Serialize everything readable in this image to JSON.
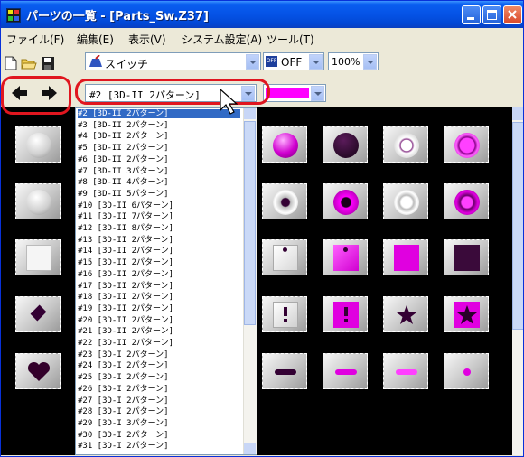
{
  "window": {
    "title": "パーツの一覧 - [Parts_Sw.Z37]"
  },
  "menubar": {
    "items": [
      "ファイル(F)",
      "編集(E)",
      "表示(V)",
      "システム設定(A)",
      "ツール(T)"
    ]
  },
  "toolbar": {
    "category_value": "スイッチ",
    "state_value": "OFF",
    "zoom_value": "100%",
    "pattern_value": "#2  [3D-II  2パターン]",
    "color_value": "#ff00ff"
  },
  "pattern_list": {
    "selected_index": 0,
    "items": [
      "#2  [3D-II  2パターン]",
      "#3  [3D-II  2パターン]",
      "#4  [3D-II  2パターン]",
      "#5  [3D-II  2パターン]",
      "#6  [3D-II  2パターン]",
      "#7  [3D-II  3パターン]",
      "#8  [3D-II  4パターン]",
      "#9  [3D-II  5パターン]",
      "#10  [3D-II  6パターン]",
      "#11  [3D-II  7パターン]",
      "#12  [3D-II  8パターン]",
      "#13  [3D-II  2パターン]",
      "#14  [3D-II  2パターン]",
      "#15  [3D-II  2パターン]",
      "#16  [3D-II  2パターン]",
      "#17  [3D-II  2パターン]",
      "#18  [3D-II  2パターン]",
      "#19  [3D-II  2パターン]",
      "#20  [3D-II  2パターン]",
      "#21  [3D-II  2パターン]",
      "#22  [3D-II  2パターン]",
      "#23  [3D-I  2パターン]",
      "#24  [3D-I  2パターン]",
      "#25  [3D-I  2パターン]",
      "#26  [3D-I  2パターン]",
      "#27  [3D-I  2パターン]",
      "#28  [3D-I  2パターン]",
      "#29  [3D-I  3パターン]",
      "#30  [3D-I  2パターン]",
      "#31  [3D-I  2パターン]"
    ]
  },
  "colors": {
    "accent": "#ff00ff",
    "highlight": "#e0161f",
    "selection": "#316ac5"
  }
}
